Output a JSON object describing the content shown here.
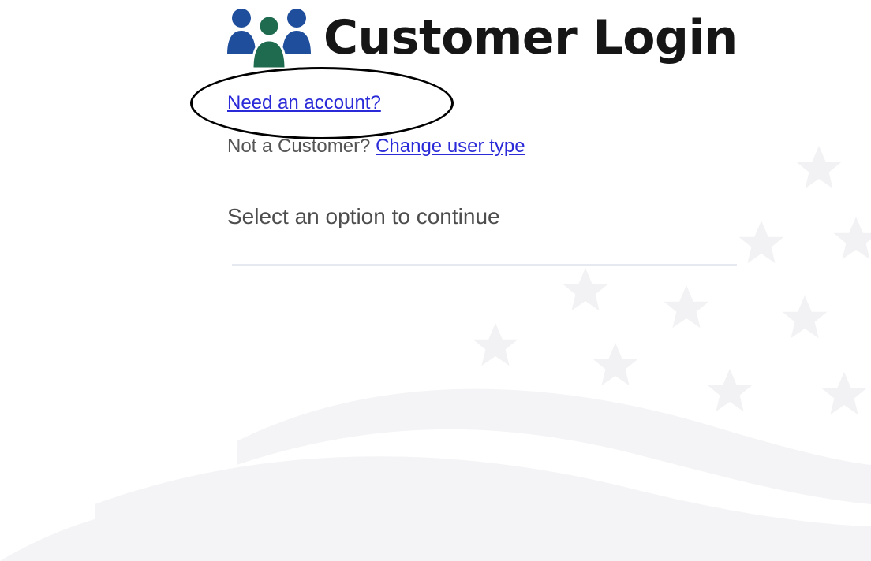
{
  "header": {
    "title": "Customer Login",
    "icon": "users-group-icon"
  },
  "links": {
    "need_account": "Need an account?",
    "not_customer_prefix": "Not a Customer?",
    "change_user_type": "Change user type"
  },
  "prompt": {
    "select_option": "Select an option to continue"
  },
  "colors": {
    "link": "#2a2ad8",
    "icon_blue": "#1f4e9c",
    "icon_green": "#1f6b4f",
    "title": "#161616"
  }
}
